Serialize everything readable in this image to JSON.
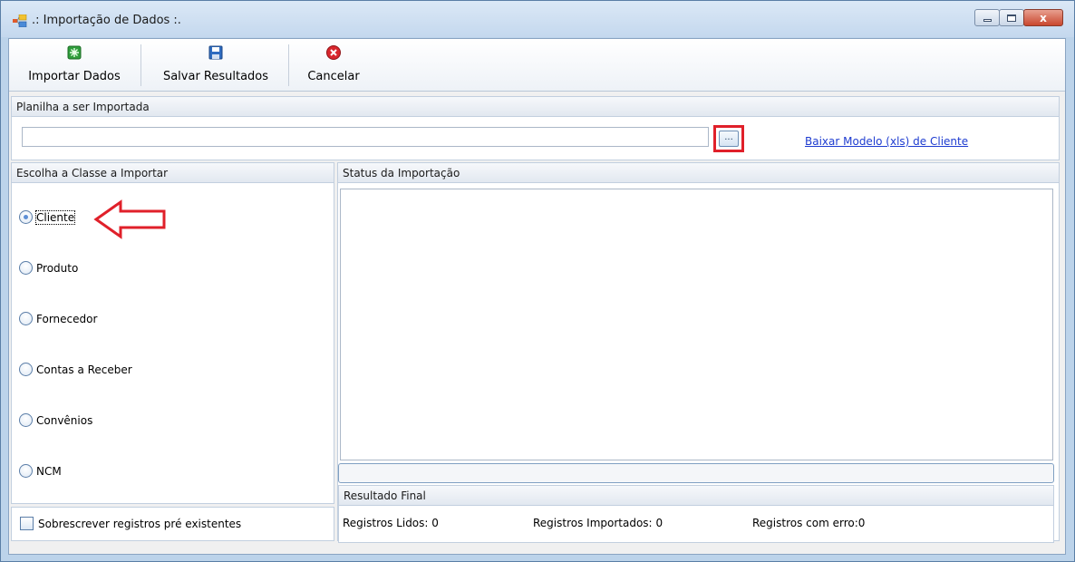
{
  "window": {
    "title": ".: Importação de Dados :.",
    "close_glyph": "x"
  },
  "toolbar": {
    "import_label": "Importar Dados",
    "save_label": "Salvar Resultados",
    "cancel_label": "Cancelar",
    "icons": {
      "import": "import-data-icon",
      "save": "floppy-disk-icon",
      "cancel": "red-circle-x-icon"
    }
  },
  "spreadsheet": {
    "header": "Planilha a ser Importada",
    "file_value": "",
    "browse_label": "...",
    "template_link": "Baixar Modelo (xls) de Cliente"
  },
  "classes": {
    "header": "Escolha a Classe a Importar",
    "options": [
      "Cliente",
      "Produto",
      "Fornecedor",
      "Contas a Receber",
      "Convênios",
      "NCM"
    ],
    "selected": "Cliente"
  },
  "overwrite": {
    "label": "Sobrescrever registros pré existentes",
    "checked": false
  },
  "status": {
    "header": "Status da Importação",
    "log": ""
  },
  "result": {
    "header": "Resultado Final",
    "read_label": "Registros Lidos:",
    "read_value": "0",
    "imported_label": "Registros Importados:",
    "imported_value": "0",
    "errors_label": "Registros com erro:",
    "errors_value": "0"
  },
  "colors": {
    "highlight": "#e0202a",
    "link": "#1e3cd0"
  }
}
